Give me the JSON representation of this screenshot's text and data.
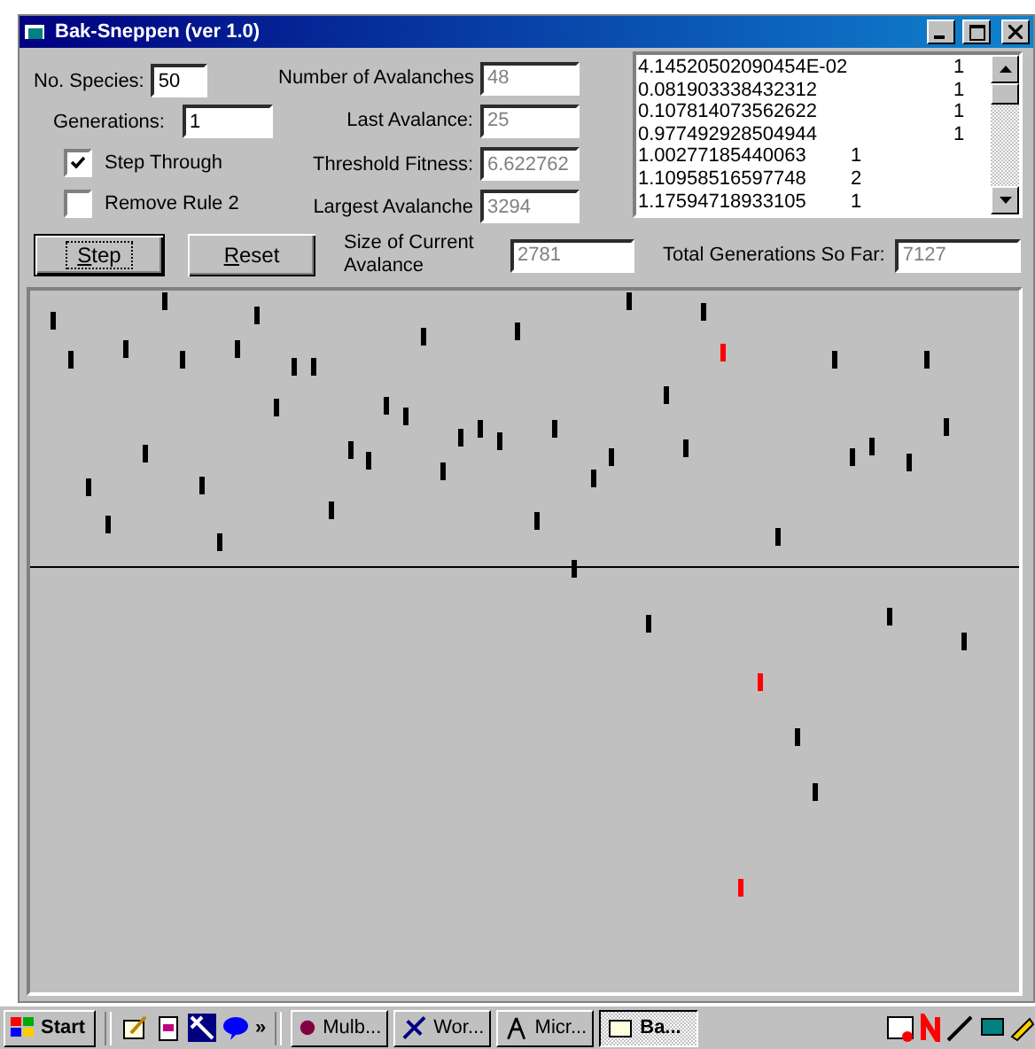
{
  "window": {
    "title": "Bak-Sneppen (ver 1.0)"
  },
  "species": {
    "label": "No. Species:",
    "value": "50"
  },
  "generations": {
    "label": "Generations:",
    "value": "1"
  },
  "checkboxes": [
    {
      "label": "Step Through",
      "checked": true
    },
    {
      "label": "Remove Rule 2",
      "checked": false
    }
  ],
  "stats": [
    {
      "label": "Number of Avalanches",
      "value": "48"
    },
    {
      "label": "Last Avalance:",
      "value": "25"
    },
    {
      "label": "Threshold Fitness:",
      "value": "6.622762"
    },
    {
      "label": "Largest Avalanche",
      "value": "3294"
    }
  ],
  "results": [
    {
      "value": "4.14520502090454E-02",
      "count": "1",
      "kind": "far"
    },
    {
      "value": "0.081903338432312",
      "count": "1",
      "kind": "far"
    },
    {
      "value": "0.107814073562622",
      "count": "1",
      "kind": "far"
    },
    {
      "value": "0.977492928504944",
      "count": "1",
      "kind": "far"
    },
    {
      "value": "1.00277185440063",
      "count": "1",
      "kind": "near"
    },
    {
      "value": "1.10958516597748",
      "count": "2",
      "kind": "near"
    },
    {
      "value": "1.17594718933105",
      "count": "1",
      "kind": "near"
    }
  ],
  "buttons": [
    {
      "label": "Step",
      "default": true
    },
    {
      "label": "Reset",
      "default": false
    }
  ],
  "current": {
    "label": "Size of Current Avalance",
    "value": "2781"
  },
  "total": {
    "label": "Total Generations So Far:",
    "value": "7127"
  },
  "taskbar": {
    "start": "Start",
    "more": "»",
    "tasks": [
      {
        "label": "Mulb...",
        "selected": false
      },
      {
        "label": "Wor...",
        "selected": false
      },
      {
        "label": "Micr...",
        "selected": false
      },
      {
        "label": "Ba...",
        "selected": true
      }
    ]
  }
}
